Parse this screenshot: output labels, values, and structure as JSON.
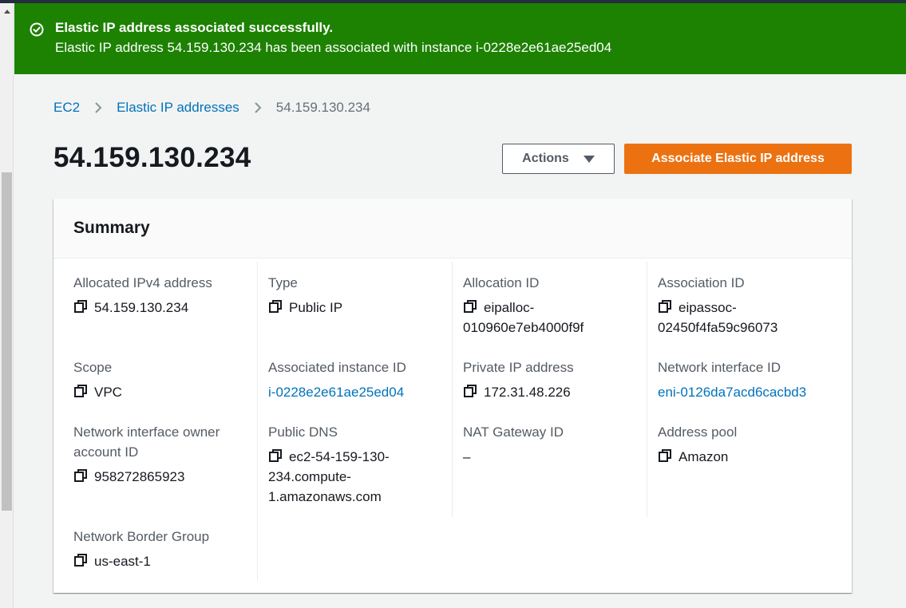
{
  "flash": {
    "title": "Elastic IP address associated successfully.",
    "message": "Elastic IP address 54.159.130.234 has been associated with instance i-0228e2e61ae25ed04",
    "color": "#1d8102"
  },
  "breadcrumb": {
    "items": [
      "EC2",
      "Elastic IP addresses"
    ],
    "current": "54.159.130.234"
  },
  "page_title": "54.159.130.234",
  "actions": {
    "actions_label": "Actions",
    "associate_label": "Associate Elastic IP address",
    "accent": "#ec7211"
  },
  "summary": {
    "title": "Summary",
    "allocated_ipv4": {
      "label": "Allocated IPv4 address",
      "value": "54.159.130.234"
    },
    "type": {
      "label": "Type",
      "value": "Public IP"
    },
    "allocation_id": {
      "label": "Allocation ID",
      "value_line1": "eipalloc-",
      "value_line2": "010960e7eb4000f9f"
    },
    "association_id": {
      "label": "Association ID",
      "value_line1": "eipassoc-",
      "value_line2": "02450f4fa59c96073"
    },
    "scope": {
      "label": "Scope",
      "value": "VPC"
    },
    "associated_instance_id": {
      "label": "Associated instance ID",
      "value": "i-0228e2e61ae25ed04"
    },
    "private_ip": {
      "label": "Private IP address",
      "value": "172.31.48.226"
    },
    "network_interface_id": {
      "label": "Network interface ID",
      "value": "eni-0126da7acd6cacbd3"
    },
    "ni_owner": {
      "label_line1": "Network interface owner",
      "label_line2": "account ID",
      "value": "958272865923"
    },
    "public_dns": {
      "label": "Public DNS",
      "value_line1": "ec2-54-159-130-",
      "value_line2": "234.compute-",
      "value_line3": "1.amazonaws.com"
    },
    "nat_gateway": {
      "label": "NAT Gateway ID",
      "value": "–"
    },
    "address_pool": {
      "label": "Address pool",
      "value": "Amazon"
    },
    "border_group": {
      "label": "Network Border Group",
      "value": "us-east-1"
    }
  }
}
